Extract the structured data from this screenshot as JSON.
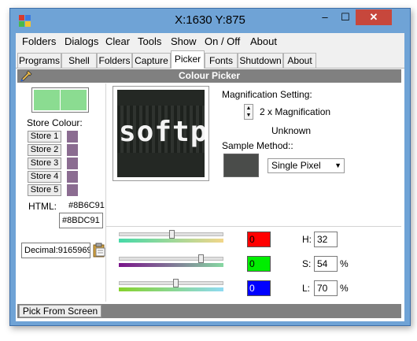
{
  "window": {
    "title": "X:1630 Y:875",
    "minimize": "–",
    "maximize": "☐",
    "close": "✕"
  },
  "menu": [
    "Folders",
    "Dialogs",
    "Clear",
    "Tools",
    "Show",
    "On / Off",
    "About"
  ],
  "tabs": [
    "Programs",
    "Shell",
    "Folders",
    "Capture",
    "Picker",
    "Fonts",
    "Shutdown",
    "About"
  ],
  "active_tab": "Picker",
  "panel": {
    "title": "Colour Picker"
  },
  "store": {
    "label": "Store Colour:",
    "buttons": [
      "Store 1",
      "Store 2",
      "Store 3",
      "Store 4",
      "Store 5"
    ],
    "swatch_color": "#8B6C91",
    "preview_color": "#8BDC91"
  },
  "html": {
    "label": "HTML:",
    "stored_value": "#8B6C91",
    "current_value": "#8BDC91"
  },
  "decimal": {
    "value": "Decimal:9165969"
  },
  "magnification": {
    "label": "Magnification Setting:",
    "value": "2 x Magnification",
    "status": "Unknown"
  },
  "sample": {
    "label": "Sample Method::",
    "selected": "Single Pixel",
    "preview_color": "#4a4c4a"
  },
  "magnified_text": "softp",
  "rgb": [
    {
      "value": "0",
      "color": "#ff0000",
      "slider_fraction": 0.51
    },
    {
      "value": "0",
      "color": "#00ee00",
      "slider_fraction": 0.8
    },
    {
      "value": "0",
      "color": "#0000ff",
      "slider_fraction": 0.55
    }
  ],
  "hsl": [
    {
      "label": "H:",
      "value": "32",
      "unit": ""
    },
    {
      "label": "S:",
      "value": "54",
      "unit": "%"
    },
    {
      "label": "L:",
      "value": "70",
      "unit": "%"
    }
  ],
  "bottom": {
    "pick_button": "Pick From Screen"
  }
}
